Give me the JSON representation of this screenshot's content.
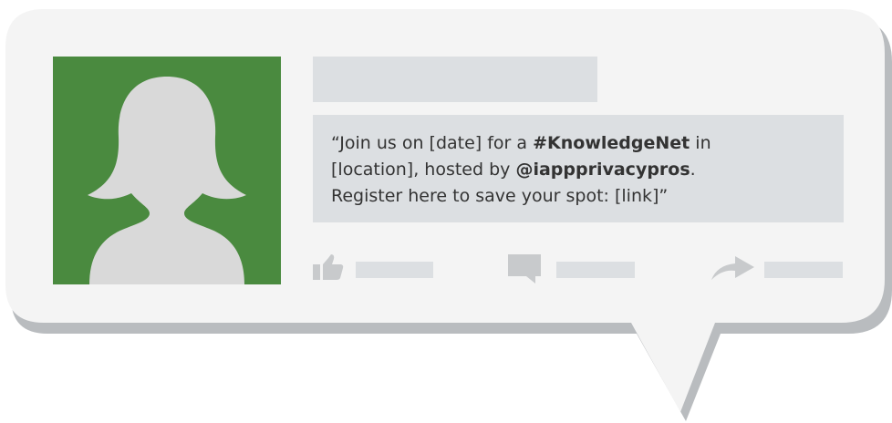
{
  "post": {
    "open_quote": "“",
    "text_1": "Join us on [date] for a ",
    "hashtag": "#KnowledgeNet",
    "text_2": " in",
    "text_3": "[location], hosted by ",
    "handle": "@iappprivacypros",
    "text_4": ".",
    "text_5": "Register here to save your spot: [link]",
    "close_quote": "”"
  },
  "icons": {
    "like": "thumbs-up-icon",
    "comment": "comment-icon",
    "share": "share-arrow-icon"
  },
  "colors": {
    "avatar_background": "#4a8a3f",
    "avatar_silhouette": "#d9d9d9",
    "placeholder_gray": "#dcdfe2",
    "bubble_fill": "#f4f4f4",
    "bubble_shadow": "#b9bcbf",
    "icon_gray": "#c8cacc"
  }
}
